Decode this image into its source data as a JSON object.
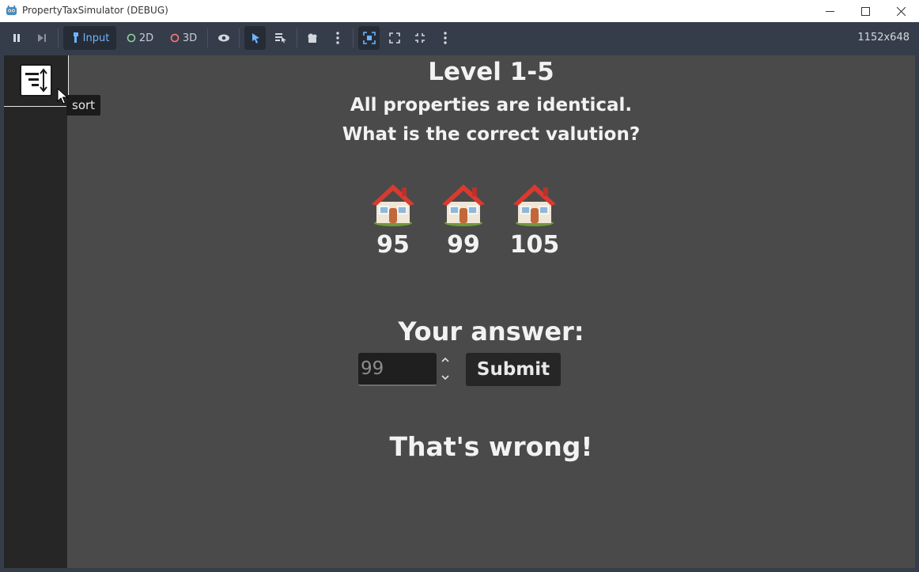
{
  "window": {
    "title": "PropertyTaxSimulator (DEBUG)",
    "controls": [
      "minimize-icon",
      "maximize-icon",
      "close-icon"
    ]
  },
  "toolbar": {
    "input_label": "Input",
    "mode_2d_label": "2D",
    "mode_3d_label": "3D",
    "resolution": "1152x648",
    "colors": {
      "input_accent": "#6fb4ff",
      "mode_2d": "#8fd39a",
      "mode_3d": "#ff7a7a"
    }
  },
  "sidebar": {
    "sort_tooltip": "sort"
  },
  "level": {
    "title": "Level 1-5",
    "line1": "All properties are identical.",
    "line2": "What is the correct valution?"
  },
  "properties": [
    {
      "value": "95"
    },
    {
      "value": "99"
    },
    {
      "value": "105"
    }
  ],
  "answer": {
    "label": "Your answer:",
    "value": "99",
    "submit_label": "Submit"
  },
  "result": "That's wrong!"
}
